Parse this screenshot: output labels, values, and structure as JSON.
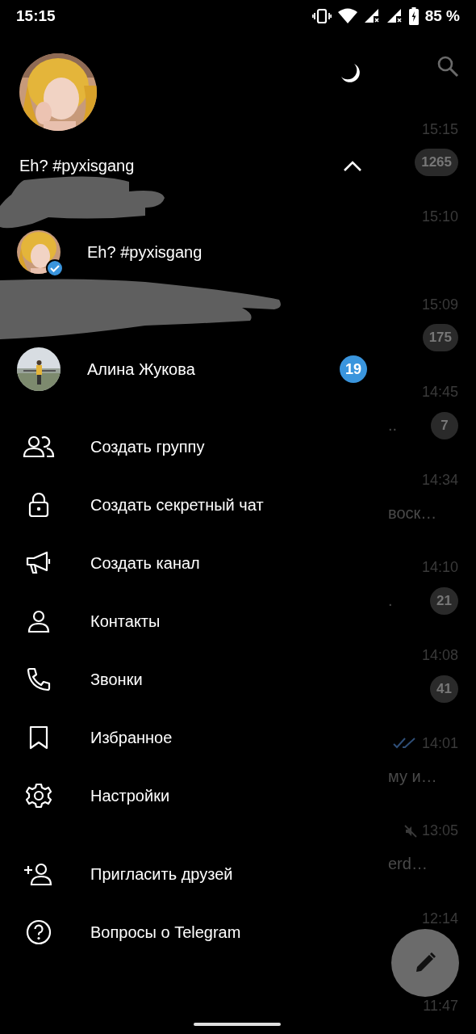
{
  "status_bar": {
    "time": "15:15",
    "battery": "85 %"
  },
  "drawer": {
    "profile": {
      "name": "Eh? #pyxisgang",
      "accounts_expanded": true
    },
    "accounts": [
      {
        "name": "Eh? #pyxisgang",
        "verified": true
      },
      {
        "name": "Алина Жукова",
        "verified": false,
        "unread": "19"
      }
    ],
    "menu": [
      {
        "kind": "group",
        "label": "Создать группу"
      },
      {
        "kind": "lock",
        "label": "Создать секретный чат"
      },
      {
        "kind": "megaphone",
        "label": "Создать канал"
      },
      {
        "kind": "person",
        "label": "Контакты"
      },
      {
        "kind": "phone",
        "label": "Звонки"
      },
      {
        "kind": "bookmark",
        "label": "Избранное"
      },
      {
        "kind": "gear",
        "label": "Настройки"
      }
    ],
    "extra_menu": [
      {
        "kind": "add-person",
        "label": "Пригласить друзей"
      },
      {
        "kind": "question",
        "label": "Вопросы о Telegram"
      }
    ]
  },
  "chat_list": [
    {
      "kind": "plain",
      "time": "15:15",
      "badge": "1265"
    },
    {
      "kind": "plain",
      "time": "15:10"
    },
    {
      "kind": "plain",
      "time": "15:09",
      "badge": "175"
    },
    {
      "kind": "plain",
      "time": "14:45",
      "preview": "..",
      "badge": "7"
    },
    {
      "kind": "plain",
      "time": "14:34",
      "preview": "воск…"
    },
    {
      "kind": "plain",
      "time": "14:10",
      "preview": ".",
      "badge": "21"
    },
    {
      "kind": "plain",
      "time": "14:08",
      "badge": "41"
    },
    {
      "kind": "read",
      "time": "14:01",
      "preview": "му и…"
    },
    {
      "kind": "muted",
      "time": "13:05",
      "preview": "erd…"
    },
    {
      "kind": "plain",
      "time": "12:14"
    },
    {
      "kind": "plain",
      "time": "11:47"
    }
  ]
}
